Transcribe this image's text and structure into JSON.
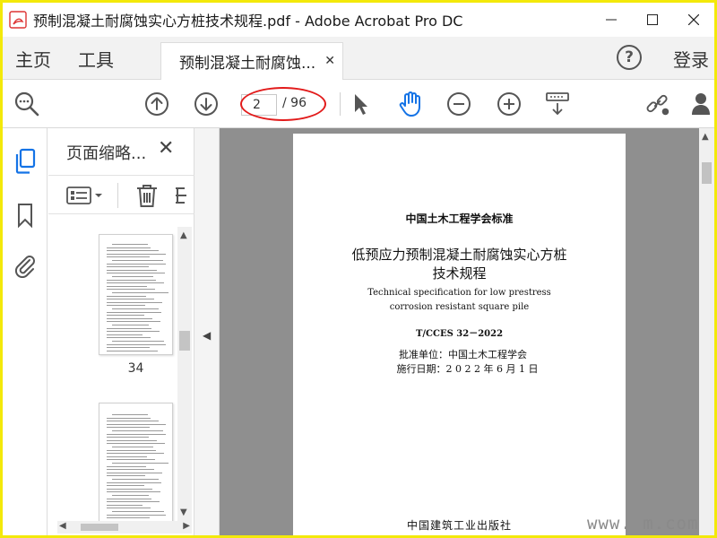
{
  "window": {
    "title": "预制混凝土耐腐蚀实心方桩技术规程.pdf - Adobe Acrobat Pro DC",
    "icon": "acrobat-icon"
  },
  "tabs": {
    "home": "主页",
    "tools": "工具",
    "document": "预制混凝土耐腐蚀...",
    "help": "?",
    "login": "登录"
  },
  "toolbar": {
    "current_page": "2",
    "total_pages": "/ 96",
    "annotation_color": "#e21b1b",
    "active_tool_color": "#1473e6"
  },
  "thumbnails_panel": {
    "title": "页面缩略...",
    "pages": [
      {
        "label": "34"
      },
      {
        "label": ""
      }
    ]
  },
  "document_page": {
    "standard_org": "中国土木工程学会标准",
    "title_line1": "低预应力预制混凝土耐腐蚀实心方桩",
    "title_line2": "技术规程",
    "english_line1": "Technical specification for low prestress",
    "english_line2": "corrosion resistant square pile",
    "code": "T/CCES 32－2022",
    "approved_by": "批准单位：中国土木工程学会",
    "effective_date": "施行日期：2 0 2 2 年 6 月 1 日",
    "publisher": "中国建筑工业出版社"
  },
  "watermark": "www.    m.com"
}
